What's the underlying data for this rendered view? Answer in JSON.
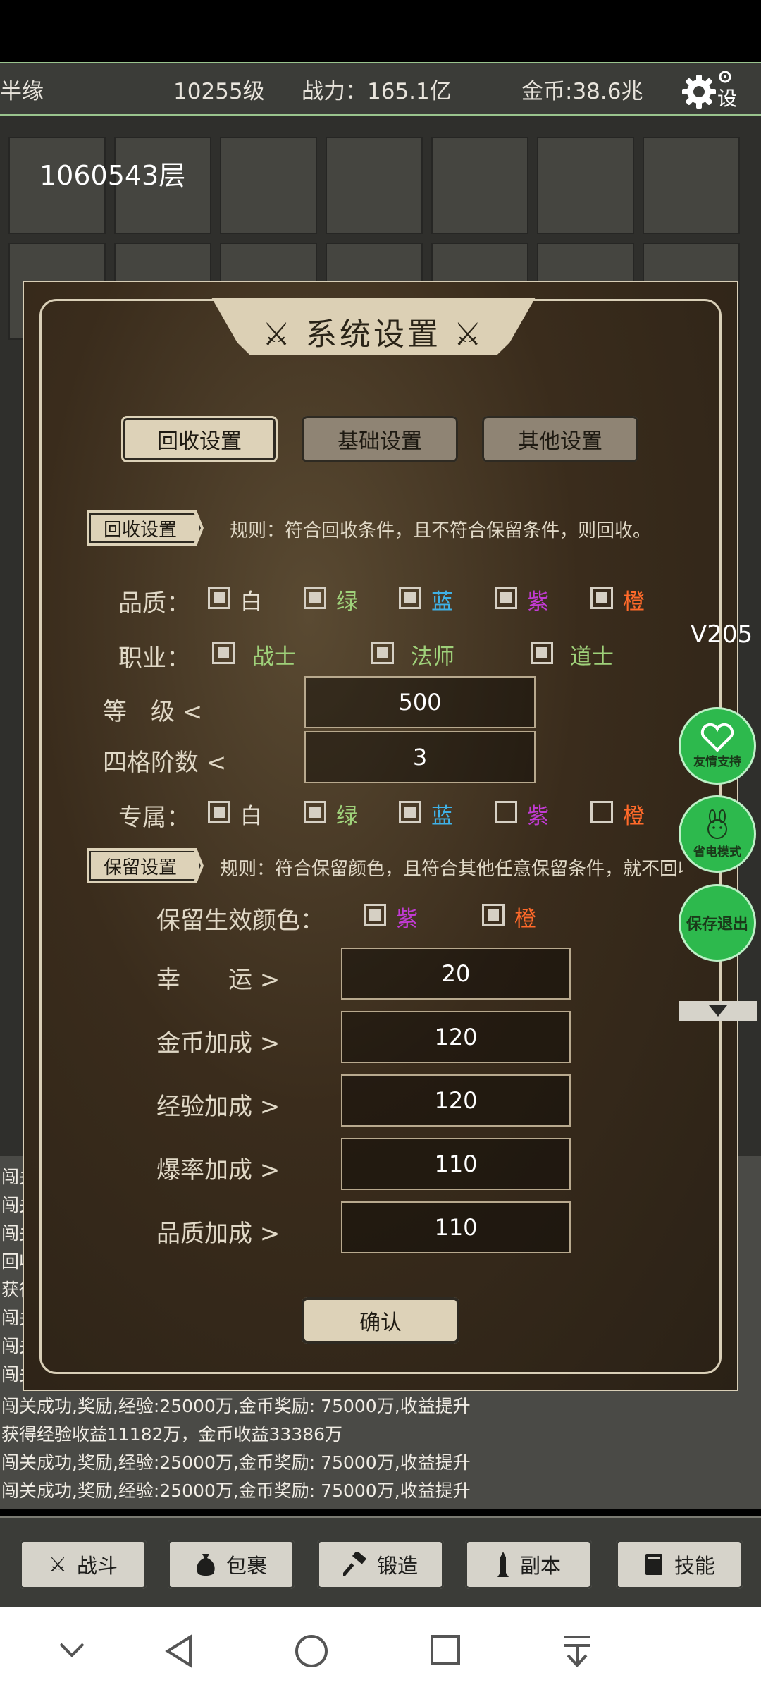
{
  "top_bar": {
    "name": "半缘",
    "level": "10255级",
    "power": "战力：165.1亿",
    "gold": "金币:38.6兆",
    "settings": "设置"
  },
  "floor": "1060543层",
  "version": "V205",
  "dialog": {
    "title": "系统设置",
    "tabs": [
      "回收设置",
      "基础设置",
      "其他设置"
    ],
    "recycle": {
      "tag": "回收设置",
      "rule": "规则：符合回收条件，且不符合保留条件，则回收。",
      "quality_label": "品质：",
      "qualities": [
        "白",
        "绿",
        "蓝",
        "紫",
        "橙"
      ],
      "job_label": "职业：",
      "jobs": [
        "战士",
        "法师",
        "道士"
      ],
      "level_label": "等　级 <",
      "level_value": "500",
      "tier_label": "四格阶数 <",
      "tier_value": "3",
      "exclusive_label": "专属：",
      "exclusive": [
        "白",
        "绿",
        "蓝",
        "紫",
        "橙"
      ]
    },
    "keep": {
      "tag": "保留设置",
      "rule": "规则：符合保留颜色，且符合其他任意保留条件，就不回收",
      "color_label": "保留生效颜色：",
      "colors": [
        "紫",
        "橙"
      ],
      "rows": [
        {
          "label": "幸　　运 >",
          "value": "20"
        },
        {
          "label": "金币加成 >",
          "value": "120"
        },
        {
          "label": "经验加成 >",
          "value": "120"
        },
        {
          "label": "爆率加成 >",
          "value": "110"
        },
        {
          "label": "品质加成 >",
          "value": "110"
        }
      ]
    },
    "confirm": "确认"
  },
  "side_buttons": {
    "support": "友情支持",
    "power_save": "省电模式",
    "save_exit": "保存退出"
  },
  "log_lines": [
    "闯关成功,奖励,经验:25000万,金币奖励: 75000万,收益提升",
    "获得经验收益11182万，金币收益33386万",
    "闯关成功,奖励,经验:25000万,金币奖励: 75000万,收益提升",
    "闯关成功,奖励,经验:25000万,金币奖励: 75000万,收益提升"
  ],
  "log_partial": [
    "闯关",
    "闯关",
    "闯关",
    "回收",
    "获得",
    "闯关",
    "闯关",
    "闯关"
  ],
  "nav": [
    "战斗",
    "包裹",
    "锻造",
    "副本",
    "技能"
  ],
  "colors": {
    "white": "#e8e2d4",
    "green": "#9fd17a",
    "blue": "#3fb1e6",
    "purple": "#c23bd4",
    "orange": "#ff6a2a"
  }
}
